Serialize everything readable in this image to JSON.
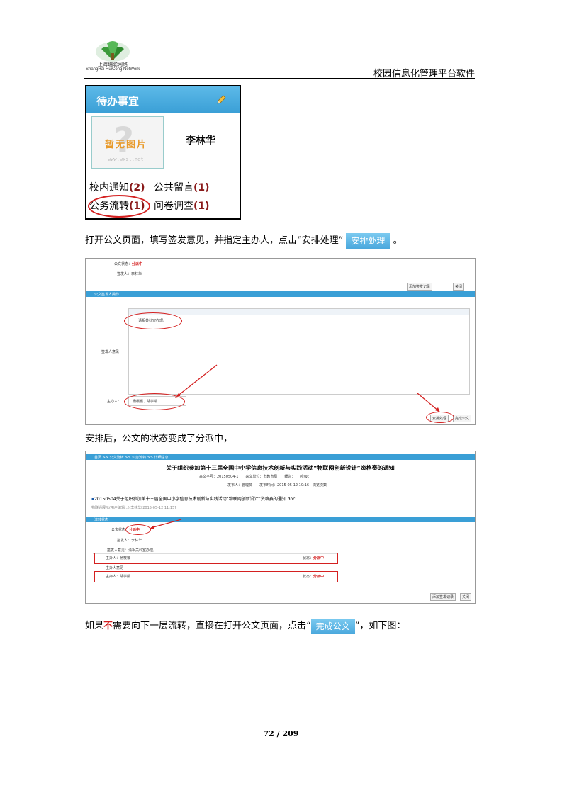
{
  "header": {
    "logo_cn": "上海瑞聪网络",
    "logo_en": "ShangHai RuiCong NetWork",
    "doc_title": "校园信息化管理平台软件"
  },
  "fig1": {
    "title": "待办事宜",
    "no_image_text": "暂无图片",
    "no_image_url": "www.wxsl.net",
    "user_name": "李林华",
    "items": [
      {
        "label": "校内通知",
        "count": "(2)"
      },
      {
        "label": "公共留言",
        "count": "(1)"
      },
      {
        "label": "公务流转",
        "count": "(1)"
      },
      {
        "label": "问卷调查",
        "count": "(1)"
      }
    ]
  },
  "para1": {
    "text": "打开公文页面，填写签发意见，并指定主办人，点击“安排处理”",
    "button": "安排处理",
    "end": "。"
  },
  "fig2": {
    "status_label": "公文状态",
    "status_value": "分派中",
    "signer_label": "签发人",
    "signer_value": "李林华",
    "btn_add_log": "添加签发记录",
    "btn_close": "关闭",
    "section": "公文签发人操作",
    "opinion_label": "签发人意见",
    "opinion_text": "请相关科室办理。",
    "host_label": "主办人",
    "host_value": "杨樱樱、胡学娟",
    "btn_arrange": "安排处理",
    "btn_finish": "完成公文"
  },
  "para2": {
    "text": "安排后，公文的状态变成了分派中，"
  },
  "fig3": {
    "breadcrumb": "首页 >> 公文流转 >> 公务流转 >> 详细信息",
    "title": "关于组织参加第十三届全国中小学信息技术创新与实践活动“物联网创新设计”资格赛的通知",
    "meta1": "来文字号：20150504-1　　来文单位：市教育局　　缓急：　　密级：",
    "meta2": "发布人：管理员　　发布时间：2015-05-12 10:16　浏览次数",
    "attachment": "20150504关于组织参加第十三届全国中小学信息技术创新与实践活动“物联网创新设计”资格赛的通知.doc",
    "attach_note": "物联通展示(用户编辑...)  李林华[2015-05-12 11:15]",
    "section": "流转状态",
    "status_label": "公文状态",
    "status_value": "分派中",
    "signer_label": "签发人",
    "signer_value": "李林华",
    "opinion_label": "签发人意见",
    "opinion_value": "请相关科室办理。",
    "rows": [
      {
        "label": "主办人",
        "name": "杨樱樱",
        "state_label": "状态",
        "state": "分派中",
        "op_label": "主办人意见"
      },
      {
        "label": "主办人",
        "name": "胡学娟",
        "state_label": "状态",
        "state": "分派中"
      }
    ],
    "btn_add_log": "添加签发记录",
    "btn_close": "关闭"
  },
  "para3": {
    "pre": "如果",
    "emph": "不",
    "post": "需要向下一层流转，直接在打开公文页面，点击“",
    "button": "完成公文",
    "end": "”，如下图："
  },
  "footer": {
    "page": "72 / 209"
  },
  "colors": {
    "accent_blue": "#3a9fd6",
    "annotation_red": "#d42020"
  }
}
